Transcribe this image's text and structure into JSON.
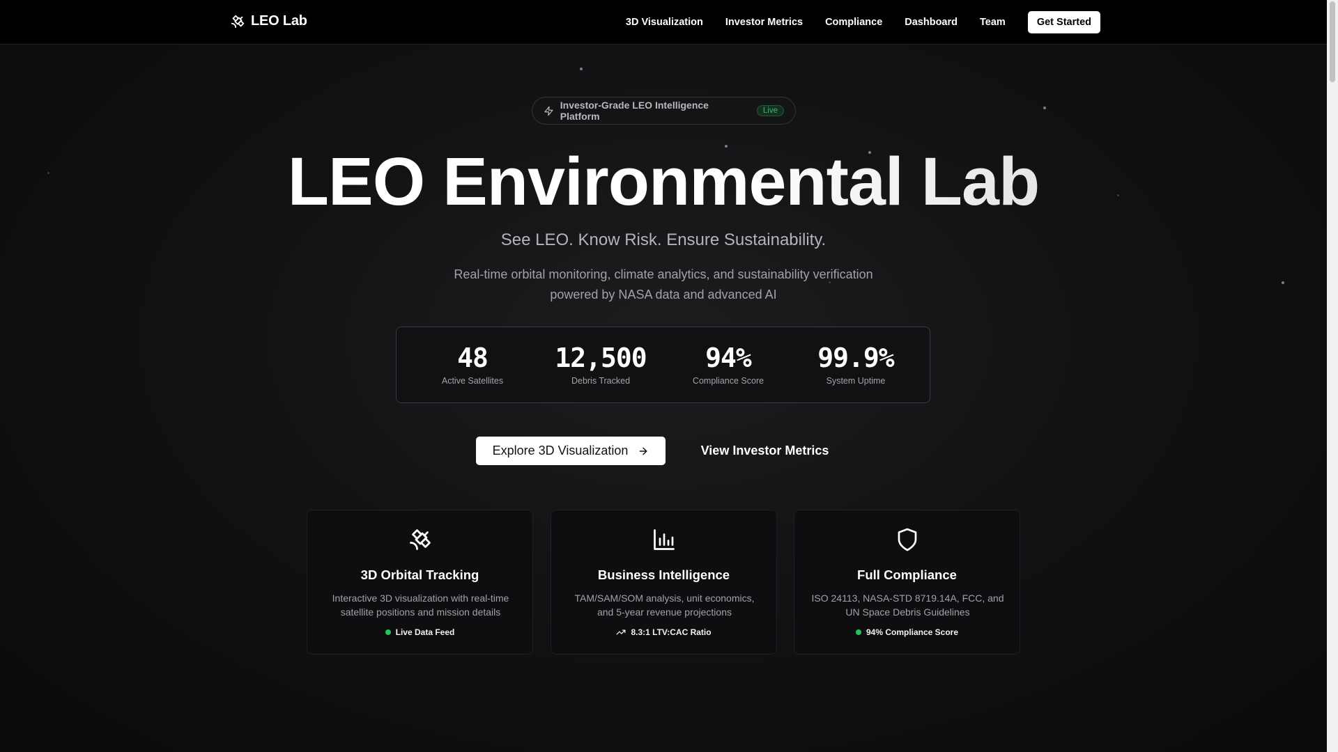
{
  "nav": {
    "brand": "LEO Lab",
    "links": [
      "3D Visualization",
      "Investor Metrics",
      "Compliance",
      "Dashboard",
      "Team"
    ],
    "cta": "Get Started"
  },
  "hero": {
    "badge": "Investor-Grade LEO Intelligence Platform",
    "badge_pill": "Live",
    "title": "LEO Environmental Lab",
    "tagline": "See LEO. Know Risk. Ensure Sustainability.",
    "description": "Real-time orbital monitoring, climate analytics, and sustainability verification powered by NASA data and advanced AI"
  },
  "stats": [
    {
      "value": "48",
      "label": "Active Satellites"
    },
    {
      "value": "12,500",
      "label": "Debris Tracked"
    },
    {
      "value": "94%",
      "label": "Compliance Score"
    },
    {
      "value": "99.9%",
      "label": "System Uptime"
    }
  ],
  "ctas": {
    "primary": "Explore 3D Visualization",
    "secondary": "View Investor Metrics"
  },
  "features": [
    {
      "icon": "satellite-icon",
      "title": "3D Orbital Tracking",
      "description": "Interactive 3D visualization with real-time satellite positions and mission details",
      "footer": "Live Data Feed"
    },
    {
      "icon": "bar-chart-icon",
      "title": "Business Intelligence",
      "description": "TAM/SAM/SOM analysis, unit economics, and 5-year revenue projections",
      "footer": "8.3:1 LTV:CAC Ratio"
    },
    {
      "icon": "shield-icon",
      "title": "Full Compliance",
      "description": "ISO 24113, NASA-STD 8719.14A, FCC, and UN Space Debris Guidelines",
      "footer": "94% Compliance Score"
    }
  ],
  "colors": {
    "background": "#0b0b0c",
    "accent_green": "#22c55e",
    "text_muted": "#a2a2a8"
  }
}
